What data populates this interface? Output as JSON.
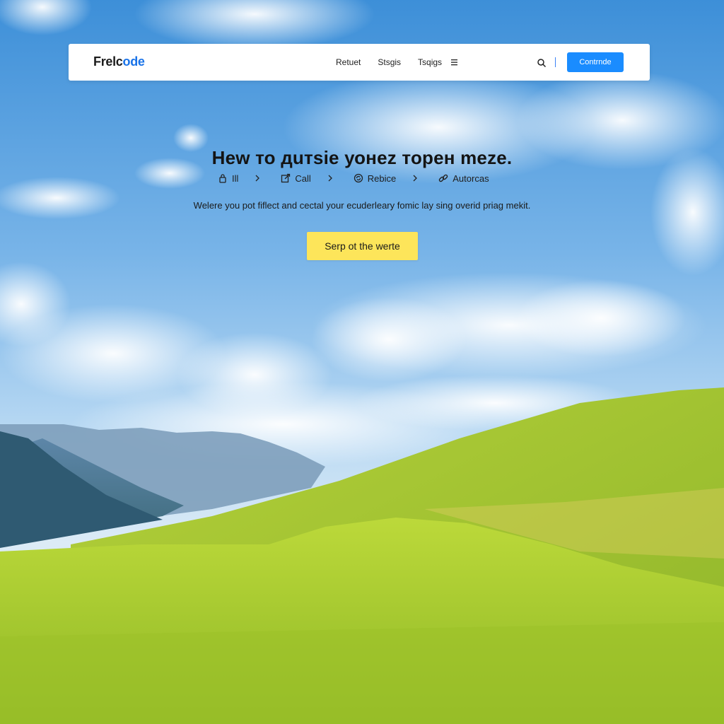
{
  "navbar": {
    "brand_prefix": "Frelc",
    "brand_suffix": "ode",
    "links": [
      "Retuet",
      "Stsgis",
      "Tsqigs"
    ],
    "menu_icon": "hamburger-icon",
    "search_icon": "search-icon",
    "cta_label": "Contrnde"
  },
  "hero": {
    "title": "Hew то дuтsie уонez торен meze.",
    "breadcrumbs": [
      {
        "label": "Ill",
        "icon": "lock-icon"
      },
      {
        "label": "Call",
        "icon": "external-link-icon"
      },
      {
        "label": "Rebice",
        "icon": "refresh-icon"
      },
      {
        "label": "Autorcas",
        "icon": "link-icon"
      }
    ],
    "subtitle": "Welere you pot fiflect and cectal your ecuderleary fomic lay sing overid priag mekit.",
    "button_label": "Serp ot the werte"
  },
  "colors": {
    "accent": "#1a8cff",
    "hero_button": "#fde55a",
    "sky_top": "#3d8fd8",
    "grass": "#b8d630"
  }
}
